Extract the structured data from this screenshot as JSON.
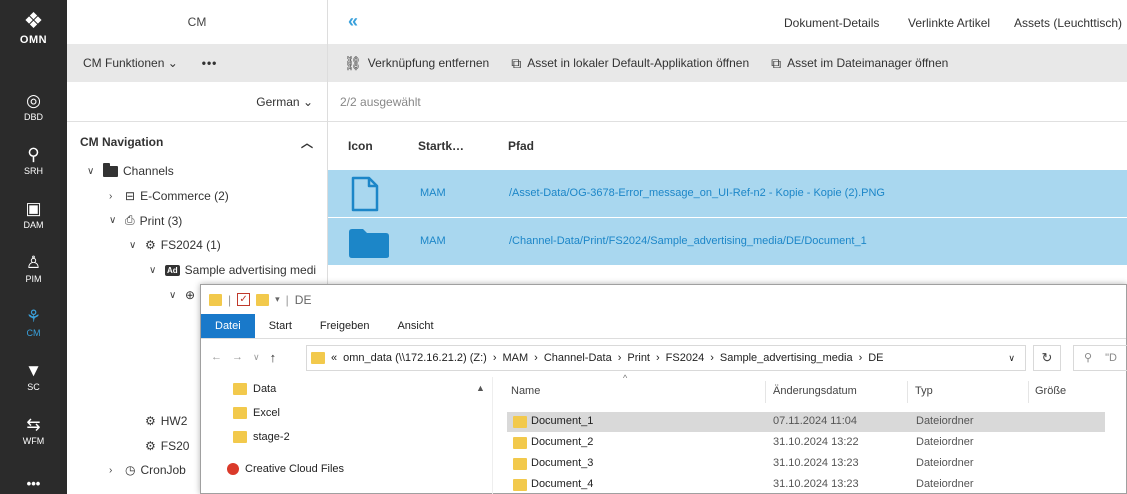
{
  "rail": {
    "logo_text": "OMN",
    "items": [
      {
        "label": "DBD",
        "icon": "dashboard-icon"
      },
      {
        "label": "SRH",
        "icon": "search-icon"
      },
      {
        "label": "DAM",
        "icon": "image-stack-icon"
      },
      {
        "label": "PIM",
        "icon": "product-icon"
      },
      {
        "label": "CM",
        "icon": "hierarchy-icon",
        "active": true
      },
      {
        "label": "SC",
        "icon": "cart-icon"
      },
      {
        "label": "WFM",
        "icon": "workflow-icon"
      },
      {
        "label": "•••",
        "icon": "more-icon"
      }
    ],
    "accent_color": "#3aa1dc"
  },
  "cm_panel": {
    "title": "CM",
    "functions_label": "CM Funktionen",
    "more_label": "•••",
    "language": "German",
    "nav_title": "CM Navigation",
    "tree": {
      "channels": "Channels",
      "ecommerce": "E-Commerce (2)",
      "print": "Print (3)",
      "fs2024": "FS2024 (1)",
      "sample": "Sample advertising medi",
      "hw": "HW2",
      "fs20": "FS20",
      "cronjobs": "CronJob"
    }
  },
  "main": {
    "tabs": [
      "Dokument-Details",
      "Verlinkte Artikel",
      "Assets (Leuchttisch)"
    ],
    "actions": {
      "unlink": "Verknüpfung entfernen",
      "open_default": "Asset in lokaler Default-Applikation öffnen",
      "open_filemanager": "Asset im Dateimanager öffnen"
    },
    "selection": "2/2 ausgewählt",
    "columns": {
      "icon": "Icon",
      "start": "Startk…",
      "path": "Pfad"
    },
    "rows": [
      {
        "icon": "file-icon",
        "start": "MAM",
        "path": "/Asset-Data/OG-3678-Error_message_on_UI-Ref-n2 - Kopie - Kopie (2).PNG"
      },
      {
        "icon": "folder-icon",
        "start": "MAM",
        "path": "/Channel-Data/Print/FS2024/Sample_advertising_media/DE/Document_1"
      }
    ]
  },
  "explorer": {
    "title": "DE",
    "ribbon": {
      "file": "Datei",
      "start": "Start",
      "share": "Freigeben",
      "view": "Ansicht"
    },
    "address": {
      "prefix": "«",
      "parts": [
        "omn_data (\\\\172.16.21.2) (Z:)",
        "MAM",
        "Channel-Data",
        "Print",
        "FS2024",
        "Sample_advertising_media",
        "DE"
      ]
    },
    "search_placeholder": "\"D",
    "nav_items": {
      "data": "Data",
      "excel": "Excel",
      "stage": "stage-2",
      "cc": "Creative Cloud Files"
    },
    "columns": {
      "name": "Name",
      "date": "Änderungsdatum",
      "type": "Typ",
      "size": "Größe"
    },
    "files": [
      {
        "name": "Document_1",
        "date": "07.11.2024 11:04",
        "type": "Dateiordner"
      },
      {
        "name": "Document_2",
        "date": "31.10.2024 13:22",
        "type": "Dateiordner"
      },
      {
        "name": "Document_3",
        "date": "31.10.2024 13:23",
        "type": "Dateiordner"
      },
      {
        "name": "Document_4",
        "date": "31.10.2024 13:23",
        "type": "Dateiordner"
      }
    ]
  }
}
